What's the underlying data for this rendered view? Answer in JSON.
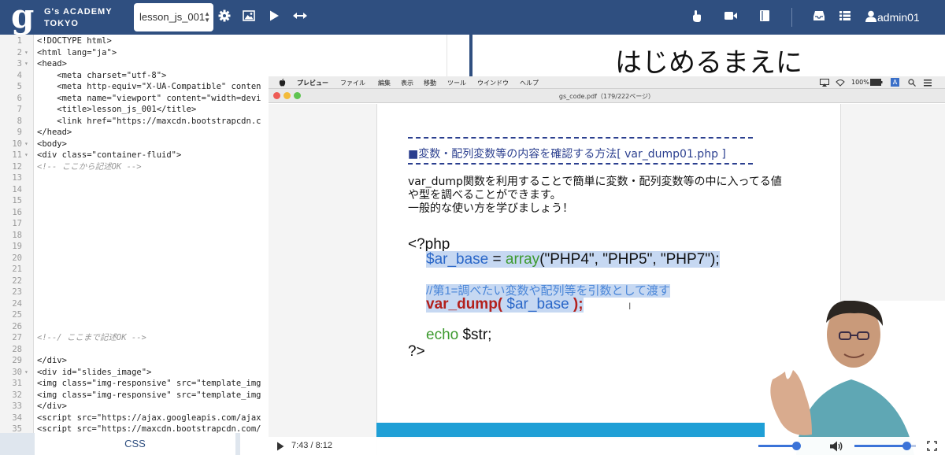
{
  "header": {
    "logo_g": "g",
    "logo_line1": "G's ACADEMY",
    "logo_line2": "TOKYO",
    "file_select": "lesson_js_001",
    "user": "admin01",
    "left_icons": [
      "gear-icon",
      "image-icon",
      "play-icon",
      "expand-horizontal-icon"
    ],
    "right_icons": [
      "hand-pointer-icon",
      "video-camera-icon",
      "book-icon",
      "inbox-icon",
      "list-icon",
      "user-icon"
    ]
  },
  "editor": {
    "lines": [
      {
        "n": "1",
        "code": "<!DOCTYPE html>",
        "fold": ""
      },
      {
        "n": "2",
        "code": "<html lang=\"ja\">",
        "fold": "▾"
      },
      {
        "n": "3",
        "code": "<head>",
        "fold": "▾"
      },
      {
        "n": "4",
        "code": "    <meta charset=\"utf-8\">",
        "fold": ""
      },
      {
        "n": "5",
        "code": "    <meta http-equiv=\"X-UA-Compatible\" conten",
        "fold": ""
      },
      {
        "n": "6",
        "code": "    <meta name=\"viewport\" content=\"width=devi",
        "fold": ""
      },
      {
        "n": "7",
        "code": "    <title>lesson_js_001</title>",
        "fold": ""
      },
      {
        "n": "8",
        "code": "    <link href=\"https://maxcdn.bootstrapcdn.c",
        "fold": ""
      },
      {
        "n": "9",
        "code": "</head>",
        "fold": ""
      },
      {
        "n": "10",
        "code": "<body>",
        "fold": "▾"
      },
      {
        "n": "11",
        "code": "<div class=\"container-fluid\">",
        "fold": "▾"
      },
      {
        "n": "12",
        "code": "<!-- ここから記述OK -->",
        "fold": "",
        "comment": true
      },
      {
        "n": "13",
        "code": "",
        "fold": ""
      },
      {
        "n": "14",
        "code": "",
        "fold": ""
      },
      {
        "n": "15",
        "code": "",
        "fold": ""
      },
      {
        "n": "16",
        "code": "",
        "fold": ""
      },
      {
        "n": "17",
        "code": "",
        "fold": ""
      },
      {
        "n": "18",
        "code": "",
        "fold": ""
      },
      {
        "n": "19",
        "code": "",
        "fold": ""
      },
      {
        "n": "20",
        "code": "",
        "fold": ""
      },
      {
        "n": "21",
        "code": "",
        "fold": ""
      },
      {
        "n": "22",
        "code": "",
        "fold": ""
      },
      {
        "n": "23",
        "code": "",
        "fold": ""
      },
      {
        "n": "24",
        "code": "",
        "fold": ""
      },
      {
        "n": "25",
        "code": "",
        "fold": ""
      },
      {
        "n": "26",
        "code": "",
        "fold": ""
      },
      {
        "n": "27",
        "code": "<!--/ ここまで記述OK -->",
        "fold": "",
        "comment": true
      },
      {
        "n": "28",
        "code": "",
        "fold": ""
      },
      {
        "n": "29",
        "code": "</div>",
        "fold": ""
      },
      {
        "n": "30",
        "code": "<div id=\"slides_image\">",
        "fold": "▾"
      },
      {
        "n": "31",
        "code": "<img class=\"img-responsive\" src=\"template_img",
        "fold": ""
      },
      {
        "n": "32",
        "code": "<img class=\"img-responsive\" src=\"template_img",
        "fold": ""
      },
      {
        "n": "33",
        "code": "</div>",
        "fold": ""
      },
      {
        "n": "34",
        "code": "<script src=\"https://ajax.googleapis.com/ajax",
        "fold": ""
      },
      {
        "n": "35",
        "code": "<script src=\"https://maxcdn.bootstrapcdn.com/",
        "fold": ""
      }
    ]
  },
  "tabs": {
    "css": "CSS"
  },
  "slide": {
    "title": "はじめるまえに"
  },
  "video": {
    "menubar": {
      "app": "プレビュー",
      "items": [
        "ファイル",
        "編集",
        "表示",
        "移動",
        "ツール",
        "ウインドウ",
        "ヘルプ"
      ],
      "battery": "100%",
      "input": "A"
    },
    "doc_title": "gs_code.pdf（179/222ページ）",
    "pdf": {
      "heading": "■変数・配列変数等の内容を確認する方法[ var_dump01.php ]",
      "desc1": "var_dump関数を利用することで簡単に変数・配列変数等の中に入ってる値",
      "desc2": "や型を調べることができます。",
      "desc3": "一般的な使い方を学びましょう！",
      "php_open": "<?php",
      "code1_var": "$ar_base",
      "code1_eq": " = ",
      "code1_fn": "array",
      "code1_args": "(\"PHP4\", \"PHP5\", \"PHP7\");",
      "comment": "//第1=調べたい変数や配列等を引数として渡す",
      "dump_fn": "var_dump( ",
      "dump_arg": "$ar_base",
      "dump_end": " );",
      "echo_kw": "echo",
      "echo_var": " $str;",
      "php_close": "?>"
    },
    "player": {
      "time": "7:43 / 8:12",
      "progress": 0.94,
      "volume": 0.85
    }
  },
  "colors": {
    "header": "#2f4f80",
    "pdf_blue": "#2b3f8f",
    "code_green": "#3d9a2f",
    "code_blue": "#2a67c8",
    "code_red": "#b3201c",
    "highlight": "#c6d8f2"
  }
}
